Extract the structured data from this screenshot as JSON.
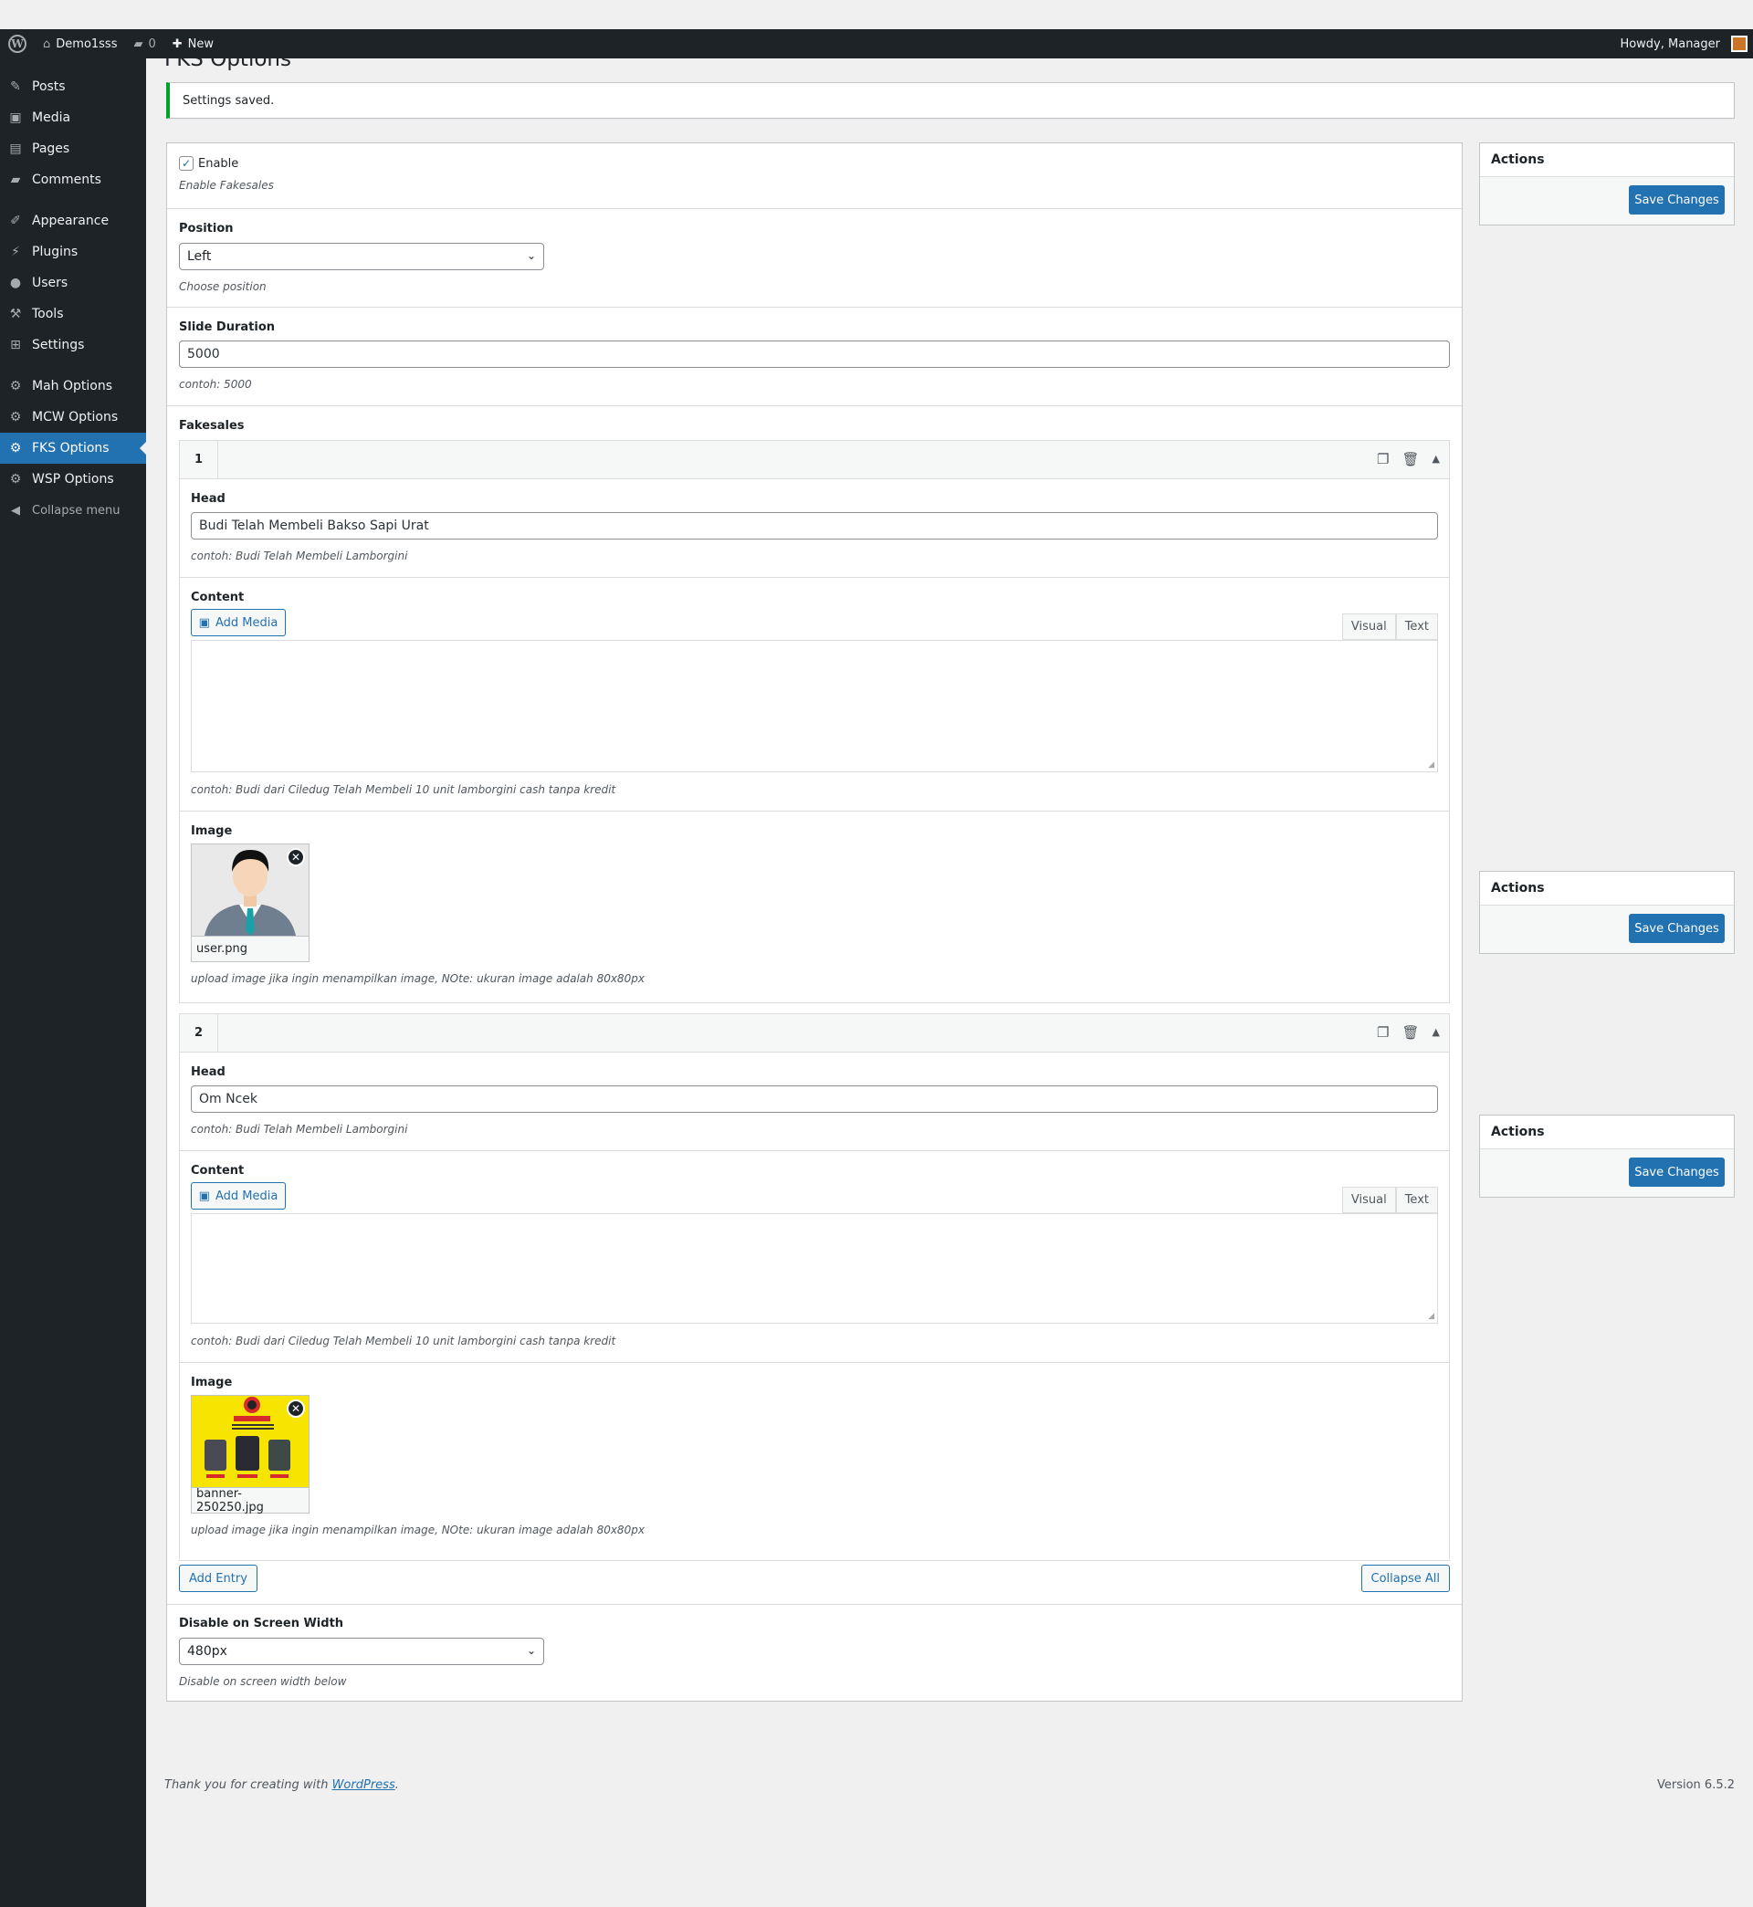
{
  "adminbar": {
    "site_name": "Demo1sss",
    "comments_count": "0",
    "new_label": "New",
    "howdy": "Howdy, Manager"
  },
  "sidebar": {
    "items": [
      {
        "label": "Posts",
        "icon": "pin-icon"
      },
      {
        "label": "Media",
        "icon": "media-icon"
      },
      {
        "label": "Pages",
        "icon": "pages-icon"
      },
      {
        "label": "Comments",
        "icon": "comment-icon"
      },
      {
        "label": "Appearance",
        "icon": "brush-icon"
      },
      {
        "label": "Plugins",
        "icon": "plug-icon"
      },
      {
        "label": "Users",
        "icon": "user-icon"
      },
      {
        "label": "Tools",
        "icon": "wrench-icon"
      },
      {
        "label": "Settings",
        "icon": "settings-icon"
      },
      {
        "label": "Mah Options",
        "icon": "gear-icon"
      },
      {
        "label": "MCW Options",
        "icon": "gear-icon"
      },
      {
        "label": "FKS Options",
        "icon": "gear-icon",
        "active": true
      },
      {
        "label": "WSP Options",
        "icon": "gear-icon"
      }
    ],
    "collapse_label": "Collapse menu"
  },
  "page": {
    "title": "FKS Options",
    "notice": "Settings saved."
  },
  "form": {
    "enable_label": "Enable",
    "enable_desc": "Enable Fakesales",
    "position_label": "Position",
    "position_value": "Left",
    "position_desc": "Choose position",
    "duration_label": "Slide Duration",
    "duration_value": "5000",
    "duration_desc": "contoh: 5000",
    "fakesales_label": "Fakesales",
    "entries": [
      {
        "number": "1",
        "head_label": "Head",
        "head_value": "Budi Telah Membeli Bakso Sapi Urat",
        "head_desc": "contoh: Budi Telah Membeli Lamborgini",
        "content_label": "Content",
        "add_media": "Add Media",
        "tab_visual": "Visual",
        "tab_text": "Text",
        "content_desc": "contoh: Budi dari Ciledug Telah Membeli 10 unit lamborgini cash tanpa kredit",
        "image_label": "Image",
        "image_name": "user.png",
        "image_desc": "upload image jika ingin menampilkan image, NOte: ukuran image adalah 80x80px"
      },
      {
        "number": "2",
        "head_label": "Head",
        "head_value": "Om Ncek",
        "head_desc": "contoh: Budi Telah Membeli Lamborgini",
        "content_label": "Content",
        "add_media": "Add Media",
        "tab_visual": "Visual",
        "tab_text": "Text",
        "content_desc": "contoh: Budi dari Ciledug Telah Membeli 10 unit lamborgini cash tanpa kredit",
        "image_label": "Image",
        "image_name": "banner-250250.jpg",
        "image_desc": "upload image jika ingin menampilkan image, NOte: ukuran image adalah 80x80px"
      }
    ],
    "add_entry": "Add Entry",
    "collapse_all": "Collapse All",
    "disable_label": "Disable on Screen Width",
    "disable_value": "480px",
    "disable_desc": "Disable on screen width below"
  },
  "actions": {
    "title": "Actions",
    "save_label": "Save Changes"
  },
  "footer": {
    "thanks_prefix": "Thank you for creating with ",
    "thanks_link": "WordPress",
    "thanks_suffix": ".",
    "version": "Version 6.5.2"
  },
  "colors": {
    "adminbar_bg": "#1d2327",
    "accent": "#2271b1",
    "notice_success": "#00a32a"
  }
}
